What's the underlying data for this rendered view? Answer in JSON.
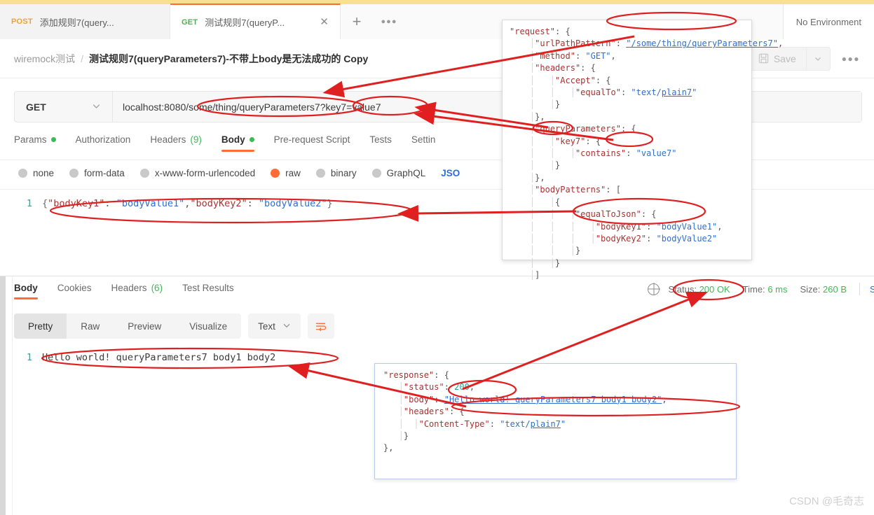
{
  "app": {
    "name": "Postman",
    "environment_label": "No Environment"
  },
  "tabs": [
    {
      "method": "POST",
      "title": "添加规则7(query...",
      "active": false
    },
    {
      "method": "GET",
      "title": "测试规则7(queryP...",
      "active": true
    }
  ],
  "tabbar": {
    "new_tab_icon": "plus-icon",
    "more_icon": "ellipsis-icon"
  },
  "breadcrumb": {
    "collection": "wiremock测试",
    "separator": "/",
    "request": "测试规则7(queryParameters7)-不带上body是无法成功的 Copy"
  },
  "actions": {
    "save_label": "Save",
    "save_icon": "floppy-disk-icon",
    "save_caret_icon": "chevron-down-icon",
    "more_icon": "ellipsis-icon"
  },
  "url_bar": {
    "method": "GET",
    "method_caret_icon": "chevron-down-icon",
    "url": "localhost:8080/some/thing/queryParameters7?key7=value7"
  },
  "request_tabs": [
    {
      "label": "Params",
      "dot": true,
      "count": "",
      "active": false
    },
    {
      "label": "Authorization",
      "dot": false,
      "count": "",
      "active": false
    },
    {
      "label": "Headers",
      "dot": false,
      "count": "(9)",
      "active": false
    },
    {
      "label": "Body",
      "dot": true,
      "count": "",
      "active": true
    },
    {
      "label": "Pre-request Script",
      "dot": false,
      "count": "",
      "active": false
    },
    {
      "label": "Tests",
      "dot": false,
      "count": "",
      "active": false
    },
    {
      "label": "Settin",
      "dot": false,
      "count": "",
      "active": false
    }
  ],
  "body_types": [
    {
      "label": "none",
      "selected": false
    },
    {
      "label": "form-data",
      "selected": false
    },
    {
      "label": "x-www-form-urlencoded",
      "selected": false
    },
    {
      "label": "raw",
      "selected": true
    },
    {
      "label": "binary",
      "selected": false
    },
    {
      "label": "GraphQL",
      "selected": false
    }
  ],
  "body_format_selected": "JSO",
  "request_body": {
    "line_number": "1",
    "open_brace": "{",
    "key1": "\"bodyKey1\"",
    "colon1": ": ",
    "val1": "\"bodyValue1\"",
    "comma": ",",
    "key2": "\"bodyKey2\"",
    "colon2": ": ",
    "val2": "\"bodyValue2\"",
    "close_brace": "}"
  },
  "response_tabs": [
    {
      "label": "Body",
      "count": "",
      "active": true
    },
    {
      "label": "Cookies",
      "count": "",
      "active": false
    },
    {
      "label": "Headers",
      "count": "(6)",
      "active": false
    },
    {
      "label": "Test Results",
      "count": "",
      "active": false
    }
  ],
  "response_status": {
    "globe_icon": "globe-icon",
    "status_label": "Status:",
    "status_value": "200 OK",
    "time_label": "Time:",
    "time_value": "6 ms",
    "size_label": "Size:",
    "size_value": "260 B",
    "cut_label": "S"
  },
  "response_toolbar": {
    "views": [
      {
        "label": "Pretty",
        "active": true
      },
      {
        "label": "Raw",
        "active": false
      },
      {
        "label": "Preview",
        "active": false
      },
      {
        "label": "Visualize",
        "active": false
      }
    ],
    "type": "Text",
    "type_caret_icon": "chevron-down-icon",
    "wrap_icon": "wrap-lines-icon"
  },
  "response_body": {
    "line_number": "1",
    "text": "Hello world! queryParameters7 body1 body2"
  },
  "request_json_panel": {
    "lines": [
      "\"request\": {",
      "    \"urlPathPattern\": \"/some/thing/queryParameters7\",",
      "    \"method\": \"GET\",",
      "    \"headers\": {",
      "        \"Accept\": {",
      "            \"equalTo\": \"text/plain7\"",
      "        }",
      "    },",
      "    \"queryParameters\": {",
      "        \"key7\": {",
      "            \"contains\": \"value7\"",
      "        }",
      "    },",
      "    \"bodyPatterns\": [",
      "        {",
      "            \"equalToJson\": {",
      "                \"bodyKey1\": \"bodyValue1\",",
      "                \"bodyKey2\": \"bodyValue2\"",
      "            }",
      "        }",
      "    ]"
    ]
  },
  "response_json_panel": {
    "lines": [
      "\"response\": {",
      "    \"status\": 200,",
      "    \"body\": \"Hello world! queryParameters7 body1 body2\",",
      "    \"headers\": {",
      "        \"Content-Type\": \"text/plain7\"",
      "    }",
      "},"
    ]
  },
  "annotations": {
    "color": "#e02020",
    "ellipse_count": 9,
    "arrow_count": 6,
    "highlighted_items": [
      "/some/thing/queryParameters7 in url bar",
      "key7=value7 in url bar",
      "urlPathPattern value",
      "key7 query parameter",
      "value7 contains",
      "bodyKey1/bodyKey2 equalToJson",
      "request body line",
      "Status: 200 OK",
      "response status 200",
      "response body Hello world! queryParameters7 body1 body2"
    ]
  },
  "watermark": {
    "text": "CSDN @毛奇志"
  }
}
